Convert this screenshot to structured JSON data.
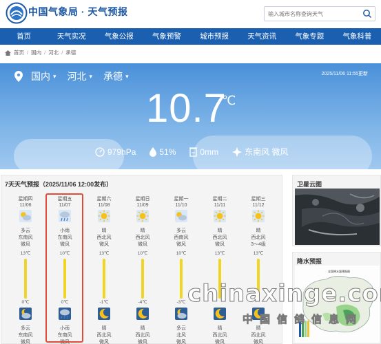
{
  "site": {
    "title": "中国气象局 · 天气预报"
  },
  "search": {
    "placeholder": "输入城市名称查询天气"
  },
  "nav": [
    "首页",
    "天气实况",
    "气象公报",
    "气象预警",
    "城市预报",
    "天气资讯",
    "气象专题",
    "气象科普"
  ],
  "breadcrumb": {
    "items": [
      "首页",
      "国内",
      "河北",
      "承德"
    ]
  },
  "location": {
    "country": "国内",
    "province": "河北",
    "city": "承德",
    "dropdown": "▾"
  },
  "updated": "2025/11/06 11:55更新",
  "current": {
    "temperature": "10.7",
    "unit": "℃",
    "pressure": "979hPa",
    "humidity": "51%",
    "rain": "0mm",
    "wind": "东南风 微风"
  },
  "forecast": {
    "title": "7天天气预报（2025/11/06 12:00发布）",
    "days": [
      {
        "weekday": "星期四",
        "date": "11/06",
        "day_icon": "partly-cloudy",
        "day_weather": "多云",
        "day_wind_dir": "东南风",
        "day_wind": "微风",
        "high": "13℃",
        "low": "0℃",
        "night_icon": "partly-cloudy-night",
        "night_weather": "多云",
        "night_wind_dir": "东南风",
        "night_wind": "微风",
        "high_value": 13,
        "low_value": 0
      },
      {
        "weekday": "星期五",
        "date": "11/07",
        "day_icon": "light-rain",
        "day_weather": "小雨",
        "day_wind_dir": "东南风",
        "day_wind": "微风",
        "high": "10℃",
        "low": "0℃",
        "night_icon": "light-rain",
        "night_weather": "小雨",
        "night_wind_dir": "东南风",
        "night_wind": "微风",
        "high_value": 10,
        "low_value": 0
      },
      {
        "weekday": "星期六",
        "date": "11/08",
        "day_icon": "sunny",
        "day_weather": "晴",
        "day_wind_dir": "西北风",
        "day_wind": "微风",
        "high": "13℃",
        "low": "-1℃",
        "night_icon": "clear-night",
        "night_weather": "晴",
        "night_wind_dir": "西北风",
        "night_wind": "微风",
        "high_value": 13,
        "low_value": -1
      },
      {
        "weekday": "星期日",
        "date": "11/09",
        "day_icon": "sunny",
        "day_weather": "晴",
        "day_wind_dir": "西北风",
        "day_wind": "微风",
        "high": "10℃",
        "low": "-4℃",
        "night_icon": "clear-night",
        "night_weather": "晴",
        "night_wind_dir": "西北风",
        "night_wind": "微风",
        "high_value": 10,
        "low_value": -4
      },
      {
        "weekday": "星期一",
        "date": "11/10",
        "day_icon": "partly-cloudy",
        "day_weather": "多云",
        "day_wind_dir": "西南风",
        "day_wind": "微风",
        "high": "10℃",
        "low": "-3℃",
        "night_icon": "partly-cloudy-night",
        "night_weather": "多云",
        "night_wind_dir": "北风",
        "night_wind": "微风",
        "high_value": 10,
        "low_value": -3
      },
      {
        "weekday": "星期二",
        "date": "11/11",
        "day_icon": "sunny",
        "day_weather": "晴",
        "day_wind_dir": "西北风",
        "day_wind": "微风",
        "high": "13℃",
        "low": "",
        "night_icon": "clear-night",
        "night_weather": "晴",
        "night_wind_dir": "西北风",
        "night_wind": "微风",
        "high_value": 13,
        "low_value": null
      },
      {
        "weekday": "星期三",
        "date": "11/12",
        "day_icon": "sunny",
        "day_weather": "晴",
        "day_wind_dir": "西北风",
        "day_wind": "3～4级",
        "high": "13℃",
        "low": "",
        "night_icon": "clear-night",
        "night_weather": "晴",
        "night_wind_dir": "西北风",
        "night_wind": "微风",
        "high_value": 13,
        "low_value": null
      }
    ]
  },
  "satellite": {
    "title": "卫星云图"
  },
  "precip": {
    "title": "降水预报",
    "map_caption": "全国降水量预报图"
  },
  "watermark": {
    "domain": "chinaxinge.com",
    "cn": "中国信鸽信息网"
  },
  "colors": {
    "nav_bg": "#1a5fb0",
    "hero_top": "#4a90d9",
    "temp_bar": "#f0d428",
    "highlight": "#e04b3c"
  }
}
